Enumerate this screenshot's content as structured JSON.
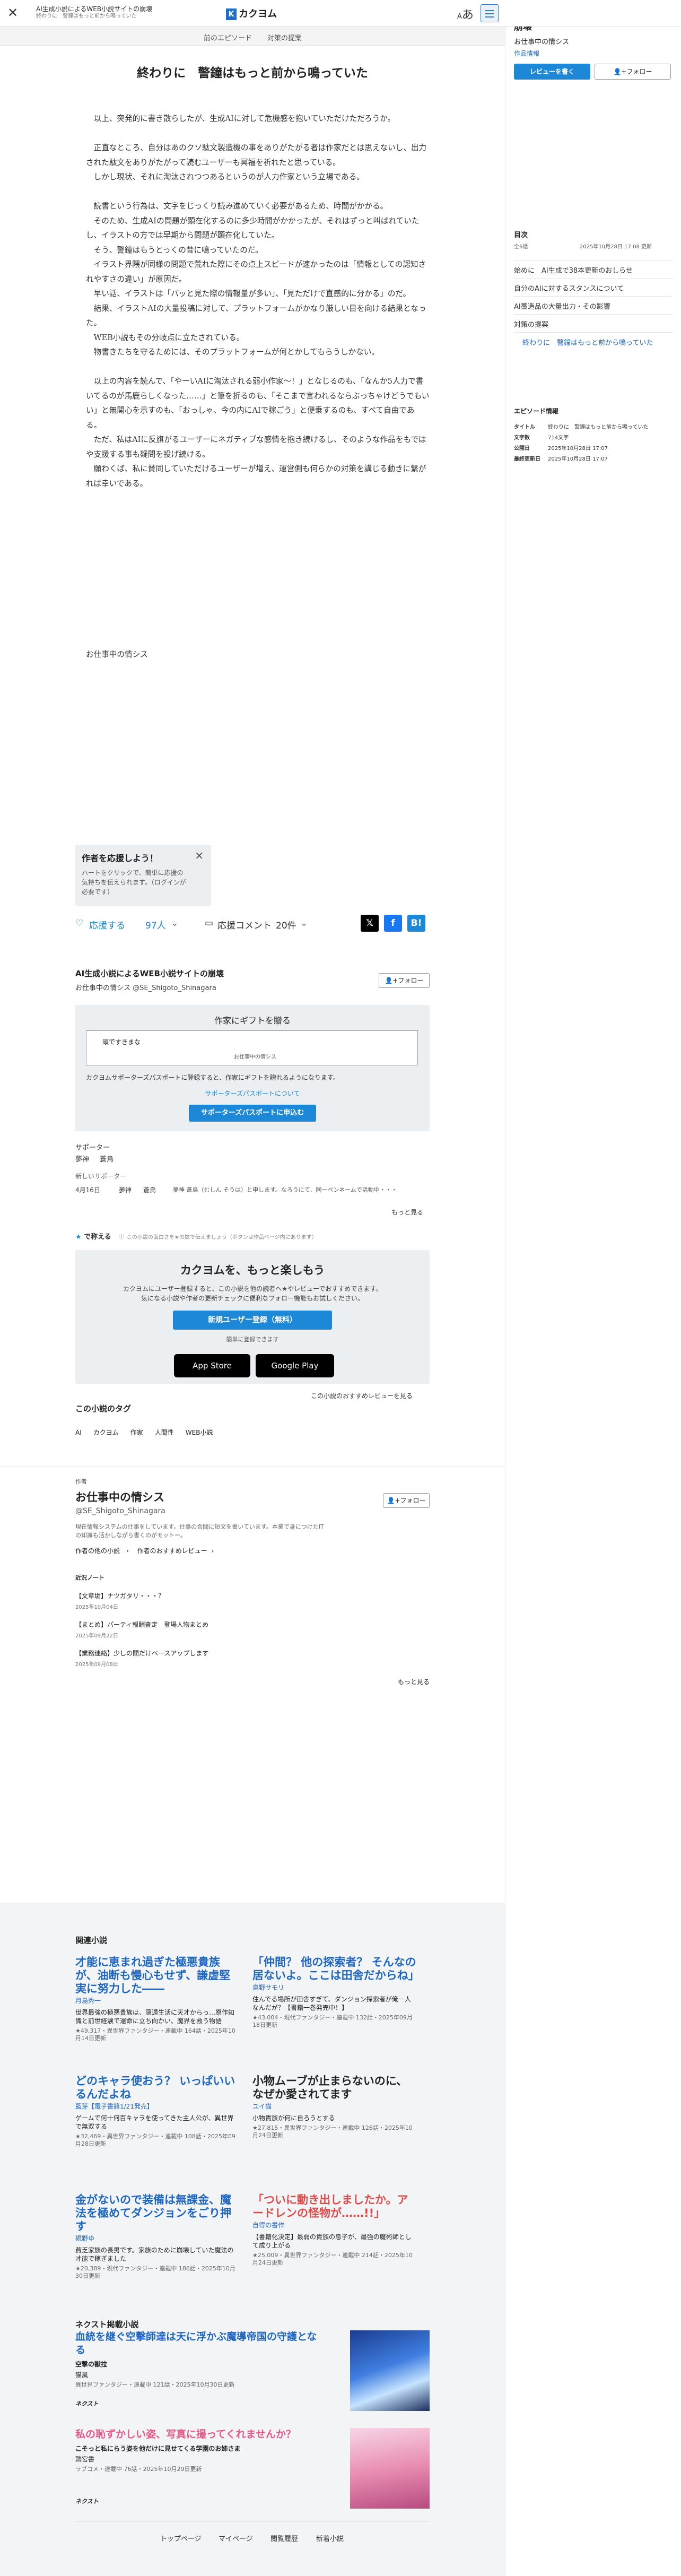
{
  "header": {
    "novel_title": "AI生成小説によるWEB小説サイトの崩壊",
    "episode_sub": "終わりに　警鐘はもっと前から鳴っていた",
    "logo": "カクヨム",
    "font_toggle": "あ"
  },
  "episode_nav": {
    "prev": "前のエピソード",
    "prev_title": "対策の提案"
  },
  "episode": {
    "title": "終わりに　警鐘はもっと前から鳴っていた",
    "paragraphs": [
      "　以上、突発的に書き散らしたが、生成AIに対して危機感を抱いていただけただろうか。",
      "",
      "　正直なところ、自分はあのクソ駄文製造機の事をありがたがる者は作家だとは思えないし、出力された駄文をありがたがって読むユーザーも冥福を祈れたと思っている。",
      "　しかし現状、それに淘汰されつつあるというのが人力作家という立場である。",
      "",
      "　読書という行為は、文字をじっくり読み進めていく必要があるため、時間がかかる。",
      "　そのため、生成AIの問題が顕在化するのに多少時間がかかったが、それはずっと叫ばれていたし、イラストの方では早期から問題が顕在化していた。",
      "　そう、警鐘はもうとっくの昔に鳴っていたのだ。",
      "　イラスト界隈が同様の問題で荒れた際にその点上スピードが速かったのは「情報としての認知されやすさの違い」が原因だ。",
      "　早い話、イラストは「パッと見た際の情報量が多い」、「見ただけで直感的に分かる」のだ。",
      "　結果、イラストAIの大量投稿に対して、プラットフォームがかなり厳しい目を向ける結果となった。",
      "　WEB小説もその分岐点に立たされている。",
      "　物書きたちを守るためには、そのプラットフォームが何とかしてもらうしかない。",
      "",
      "　以上の内容を読んで、「やーいAIに淘汰される弱小作家〜！」となじるのも、「なんか5人力で書いてるのが馬鹿らしくなった……」と筆を折るのも、「そこまで言われるならぶっちゃけどうでもいい」と無関心を示すのも、「おっしゃ、今の内にAIで稼ごう」と便乗するのも、すべて自由である。",
      "　ただ、私はAIに反旗がるユーザーにネガティブな感情を抱き続けるし、そのような作品をもではや支援する事も疑問を投げ続ける。",
      "　願わくば、私に賛同していただけるユーザーが増え、運営側も何らかの対策を講じる動きに繋がれば幸いである。"
    ],
    "signature": "お仕事中の情シス"
  },
  "tip": {
    "title": "作者を応援しよう！",
    "text": "ハートをクリックで、簡単に応援の気持ちを伝えられます。（ログインが必要です）"
  },
  "actions": {
    "cheer": "応援する",
    "cheer_count": "97人",
    "comment": "応援コメント",
    "comment_count": "20件"
  },
  "author_box": {
    "novel_title": "AI生成小説によるWEB小説サイトの崩壊",
    "author": "お仕事中の情シス @SE_Shigoto_Shinagara",
    "follow": "フォロー"
  },
  "gift": {
    "title": "作家にギフトを贈る",
    "card_text": "頑ですきまな",
    "card_sub": "お仕事中の情シス",
    "desc": "カクヨムサポーターズパスポートに登録すると、作家にギフトを贈れるようになります。",
    "link": "サポーターズパスポートについて",
    "button": "サポーターズパスポートに申込む"
  },
  "supporters": {
    "label": "サポーター",
    "names": [
      "夢神",
      "蒼烏"
    ],
    "new_label": "新しいサポーター",
    "date": "4月16日",
    "user1": "夢神",
    "user2": "蒼烏",
    "msg": "夢神 蒼烏（むしん そうは）と申します。なろうにて、同一ペンネームで活動中・・・",
    "more": "もっと見る"
  },
  "review_hint": {
    "label": "で称える",
    "text": "この小説の面白さを★の数で伝えましょう（ボタンは作品ページ内にあります）"
  },
  "promo": {
    "title": "カクヨムを、もっと楽しもう",
    "text": "カクヨムにユーザー登録すると、この小説を他の読者へ★やレビューでおすすめできます。気になる小説や作者の更新チェックに便利なフォロー機能もお試しください。",
    "button": "新規ユーザー登録（無料）",
    "sub": "簡単に登録できます",
    "app1": "App Store",
    "app2": "Google Play",
    "more_reviews": "この小説のおすすめレビューを見る"
  },
  "tags": {
    "title": "この小説のタグ",
    "items": [
      "AI",
      "カクヨム",
      "作家",
      "人間性",
      "WEB小説"
    ]
  },
  "writer": {
    "label": "作者",
    "name": "お仕事中の情シス",
    "id": "@SE_Shigoto_Shinagara",
    "follow": "フォロー",
    "bio": "現在情報システムの仕事をしています。仕事の合間に短文を書いています。本業で身につけたITの知識も活かしながら書くのがモットー。",
    "links": [
      "作者の他の小説",
      "作者のおすすめレビュー"
    ],
    "notes_label": "近況ノート",
    "notes": [
      {
        "title": "【文章垢】ナツガタリ・・・？",
        "date": "2025年10月04日"
      },
      {
        "title": "【まとめ】パーティ報酬査定　登場人物まとめ",
        "date": "2025年09月22日"
      },
      {
        "title": "【業務連絡】少しの間だけペースアップします",
        "date": "2025年09月08日"
      }
    ],
    "more": "もっと見る"
  },
  "related": {
    "title": "関連小説",
    "items": [
      {
        "title": "才能に恵まれ過ぎた極悪貴族が、油断も慢心もせず、謙虚堅実に努力した――",
        "author": "月島秀一",
        "desc": "世界最強の極悪貴族は、隠遁生活に天才からっ…原作知識と前世経験で運命に立ち向かい、魔界を救う物語",
        "meta": "★49,317・異世界ファンタジー・連載中 164話・2025年10月14日更新"
      },
      {
        "title": "「仲間？ 他の探索者？ そんなの居ないよ。ここは田舎だからね」",
        "author": "鳥野サモリ",
        "desc": "住んでる場所が田舎すぎて、ダンジョン探索者が俺一人なんだが？【書籍一巻発売中！】",
        "meta": "★43,004・現代ファンタジー・連載中 132話・2025年09月18日更新"
      },
      {
        "title": "どのキャラ使おう？ いっぱいいるんだよね",
        "author": "藍芽【電子書籍1/21発売】",
        "desc": "ゲームで何十何百キャラを使ってきた主人公が、異世界で無双する",
        "meta": "★32,469・異世界ファンタジー・連載中 108話・2025年09月28日更新"
      },
      {
        "title": "小物ムーブが止まらないのに、なぜか愛されてます",
        "author": "ユイ猫",
        "desc": "小物貴族が何に自ろうとする",
        "meta": "★27,815・異世界ファンタジー・連載中 126話・2025年10月24日更新"
      },
      {
        "title": "金がないので装備は無課金、魔法を極めてダンジョンをごり押す",
        "author": "硯野ゆ",
        "desc": "貧乏家族の長男です。家族のために崩壊していた魔法の才能で稼ぎました",
        "meta": "★20,389・現代ファンタジー・連載中 186話・2025年10月30日更新"
      },
      {
        "title": "「ついに動き出しましたか。アードレンの怪物が……!!」",
        "author": "自得の書作",
        "desc": "【書籍化決定】最弱の貴族の息子が、最強の魔術師として成り上がる",
        "meta": "★25,009・異世界ファンタジー・連載中 214話・2025年10月24日更新"
      }
    ]
  },
  "next_novels": {
    "title": "ネクスト掲載小説",
    "items": [
      {
        "title": "血統を継ぐ空擊師達は天に浮かぶ魔導帝国の守護となる",
        "sub": "空撃の獣拉",
        "author": "猫風",
        "meta": "異世界ファンタジー・連載中 121話・2025年10月30日更新"
      },
      {
        "title": "私の恥ずかしい姿、写真に撮ってくれませんか？",
        "sub": "こそっと私にらう姿を他だけに見せてくる学園のお姉さま",
        "author": "鶏宮書",
        "meta": "ラブコメ・連載中 76話・2025年10月29日更新"
      }
    ]
  },
  "footer": {
    "links": [
      "トップページ",
      "マイページ",
      "閲覧履歴",
      "新着小説"
    ]
  },
  "sidebar": {
    "novel_title": "AI生成小説によるWEB小説サイトの崩壊",
    "author": "お仕事中の情シス",
    "work_info": "作品情報",
    "cheer_btn": "レビューを書く",
    "follow_btn": "フォロー",
    "toc_label": "目次",
    "toc_meta_left": "全6話",
    "toc_meta_right": "2025年10月28日 17:08 更新",
    "toc": [
      "始めに　AI生成で38本更新のおしらせ",
      "自分のAIに対するスタンスについて",
      "AI藁造品の大量出力・その影響",
      "対策の提案",
      "終わりに　警鐘はもっと前から鳴っていた"
    ],
    "ep_info_label": "エピソード情報",
    "ep_info": [
      [
        "タイトル",
        "終わりに　警鐘はもっと前から鳴っていた"
      ],
      [
        "文字数",
        "714文字"
      ],
      [
        "公開日",
        "2025年10月28日 17:07"
      ],
      [
        "最終更新日",
        "2025年10月28日 17:07"
      ]
    ]
  },
  "colors": {
    "accent": "#1d87d8",
    "link": "#1d66c4",
    "red": "#e24a4a"
  }
}
